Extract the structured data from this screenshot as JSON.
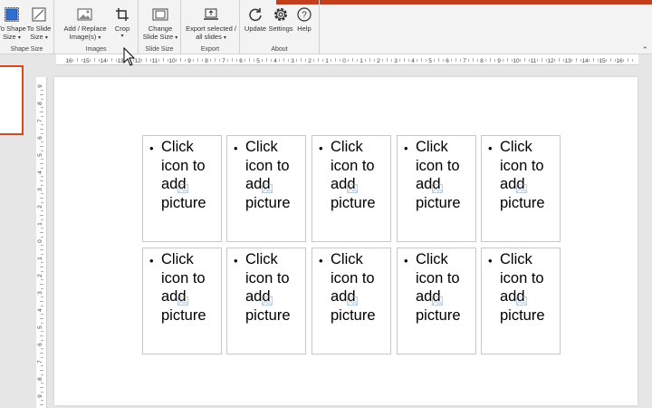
{
  "ribbon": {
    "groups": [
      {
        "label": "Shape Size"
      },
      {
        "label": "Images"
      },
      {
        "label": "Slide Size"
      },
      {
        "label": "Export"
      },
      {
        "label": "About"
      }
    ],
    "buttons": {
      "to_shape": {
        "line1": "To Shape",
        "line2": "Size"
      },
      "to_slide": {
        "line1": "To Slide",
        "line2": "Size"
      },
      "add_replace": {
        "line1": "Add / Replace",
        "line2": "Image(s)"
      },
      "crop": {
        "line1": "Crop"
      },
      "change_slide": {
        "line1": "Change",
        "line2": "Slide Size"
      },
      "export_sel": {
        "line1": "Export selected /",
        "line2": "all slides"
      },
      "update": {
        "line1": "Update"
      },
      "settings": {
        "line1": "Settings"
      },
      "help": {
        "line1": "Help"
      }
    },
    "accent_color": "#c43e1c"
  },
  "ruler": {
    "h_labels": [
      "16",
      "15",
      "14",
      "13",
      "12",
      "11",
      "10",
      "9",
      "8",
      "7",
      "6",
      "5",
      "4",
      "3",
      "2",
      "1",
      "0",
      "1",
      "2",
      "3",
      "4",
      "5",
      "6",
      "7",
      "8",
      "9",
      "10",
      "11",
      "12",
      "13",
      "14",
      "15",
      "16"
    ],
    "v_labels": [
      "9",
      "8",
      "7",
      "6",
      "5",
      "4",
      "3",
      "2",
      "1",
      "0",
      "1",
      "2",
      "3",
      "4",
      "5",
      "6",
      "7",
      "8",
      "9"
    ]
  },
  "slide": {
    "placeholders": [
      {
        "bullet": "•",
        "l1": "Click",
        "l2": "icon to",
        "l3": "add",
        "l4": "picture"
      },
      {
        "bullet": "•",
        "l1": "Click",
        "l2": "icon to",
        "l3": "add",
        "l4": "picture"
      },
      {
        "bullet": "•",
        "l1": "Click",
        "l2": "icon to",
        "l3": "add",
        "l4": "picture"
      },
      {
        "bullet": "•",
        "l1": "Click",
        "l2": "icon to",
        "l3": "add",
        "l4": "picture"
      },
      {
        "bullet": "•",
        "l1": "Click",
        "l2": "icon to",
        "l3": "add",
        "l4": "picture"
      },
      {
        "bullet": "•",
        "l1": "Click",
        "l2": "icon to",
        "l3": "add",
        "l4": "picture"
      },
      {
        "bullet": "•",
        "l1": "Click",
        "l2": "icon to",
        "l3": "add",
        "l4": "picture"
      },
      {
        "bullet": "•",
        "l1": "Click",
        "l2": "icon to",
        "l3": "add",
        "l4": "picture"
      },
      {
        "bullet": "•",
        "l1": "Click",
        "l2": "icon to",
        "l3": "add",
        "l4": "picture"
      },
      {
        "bullet": "•",
        "l1": "Click",
        "l2": "icon to",
        "l3": "add",
        "l4": "picture"
      }
    ]
  },
  "thumbnail": {
    "selected_color": "#d24726"
  },
  "icons": [
    "to-shape-size-icon",
    "to-slide-size-icon",
    "add-image-icon",
    "crop-icon",
    "change-slide-size-icon",
    "export-icon",
    "update-icon",
    "settings-icon",
    "help-icon",
    "picture-placeholder-icon",
    "mouse-cursor-icon"
  ]
}
